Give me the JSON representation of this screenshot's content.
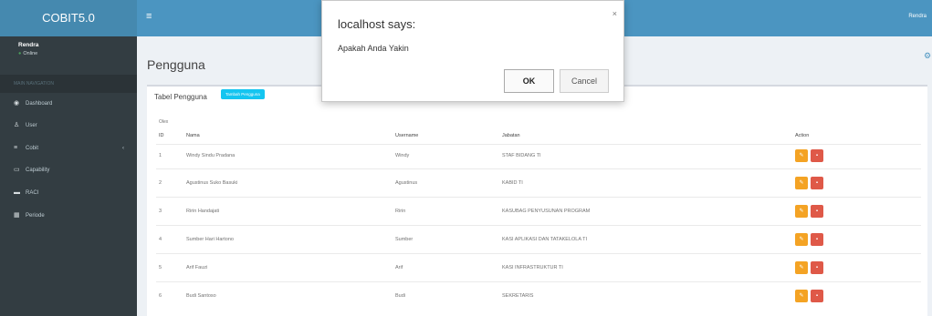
{
  "app": {
    "logo": "COBIT5.0"
  },
  "user": {
    "name": "Rendra",
    "status": "Online",
    "topbar_name": "Rendra"
  },
  "sidebar": {
    "header": "MAIN NAVIGATION",
    "items": [
      {
        "label": "Dashboard",
        "icon": "dashboard-icon"
      },
      {
        "label": "User",
        "icon": "users-icon"
      },
      {
        "label": "Cobit",
        "icon": "list-icon"
      },
      {
        "label": "Capability",
        "icon": "chart-icon"
      },
      {
        "label": "RACI",
        "icon": "table-icon"
      },
      {
        "label": "Periode",
        "icon": "calendar-icon"
      }
    ]
  },
  "page": {
    "title": "Pengguna"
  },
  "box": {
    "title": "Tabel Pengguna",
    "add_button": "Tambah Pengguna",
    "small_label": "Olex"
  },
  "table": {
    "headers": {
      "id": "ID",
      "nama": "Nama",
      "username": "Username",
      "jabatan": "Jabatan",
      "action": "Action"
    },
    "rows": [
      {
        "id": "1",
        "nama": "Windy Sindu Pradana",
        "username": "Windy",
        "jabatan": "STAF BIDANG TI"
      },
      {
        "id": "2",
        "nama": "Agustinus Suko Basuki",
        "username": "Agustinus",
        "jabatan": "KABID TI"
      },
      {
        "id": "3",
        "nama": "Ririn Handajati",
        "username": "Ririn",
        "jabatan": "KASUBAG PENYUSUNAN PROGRAM"
      },
      {
        "id": "4",
        "nama": "Sumber Hari Hartono",
        "username": "Sumber",
        "jabatan": "KASI APLIKASI DAN TATAKELOLA TI"
      },
      {
        "id": "5",
        "nama": "Arif Fauzi",
        "username": "Arif",
        "jabatan": "KASI INFRASTRUKTUR TI"
      },
      {
        "id": "6",
        "nama": "Budi Santoso",
        "username": "Budi",
        "jabatan": "SEKRETARIS"
      }
    ]
  },
  "dialog": {
    "title": "localhost says:",
    "message": "Apakah Anda Yakin",
    "ok": "OK",
    "cancel": "Cancel"
  },
  "colors": {
    "topbar": "#3c8dbc",
    "logo_bg": "#367fa9",
    "sidebar": "#222d32",
    "add_button": "#00c0ef",
    "edit_button": "#f39c12",
    "delete_button": "#dd4b39"
  }
}
